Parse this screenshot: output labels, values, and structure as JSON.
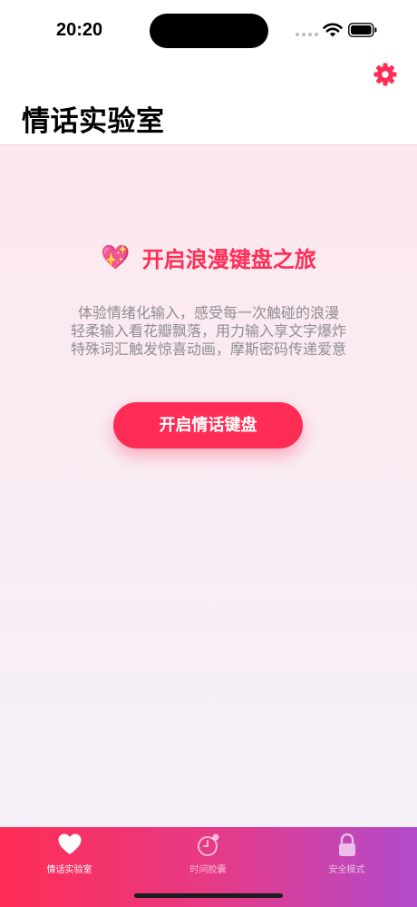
{
  "status": {
    "time": "20:20"
  },
  "nav": {
    "title": "情话实验室",
    "settings_icon": "gear-icon"
  },
  "main": {
    "heading_emoji": "💖",
    "heading": "开启浪漫键盘之旅",
    "description": [
      "体验情绪化输入，感受每一次触碰的浪漫",
      "轻柔输入看花瓣飘落，用力输入享文字爆炸",
      "特殊词汇触发惊喜动画，摩斯密码传递爱意"
    ],
    "cta_label": "开启情话键盘"
  },
  "tabbar": {
    "tabs": [
      {
        "label": "情话实验室",
        "icon": "heart-icon",
        "active": true
      },
      {
        "label": "时间胶囊",
        "icon": "clock-icon",
        "active": false
      },
      {
        "label": "安全模式",
        "icon": "lock-icon",
        "active": false
      }
    ]
  },
  "colors": {
    "accent": "#ff2d55",
    "tabbar_start": "#ff2d55",
    "tabbar_end": "#b24bcc",
    "desc_text": "#8e8e93"
  }
}
